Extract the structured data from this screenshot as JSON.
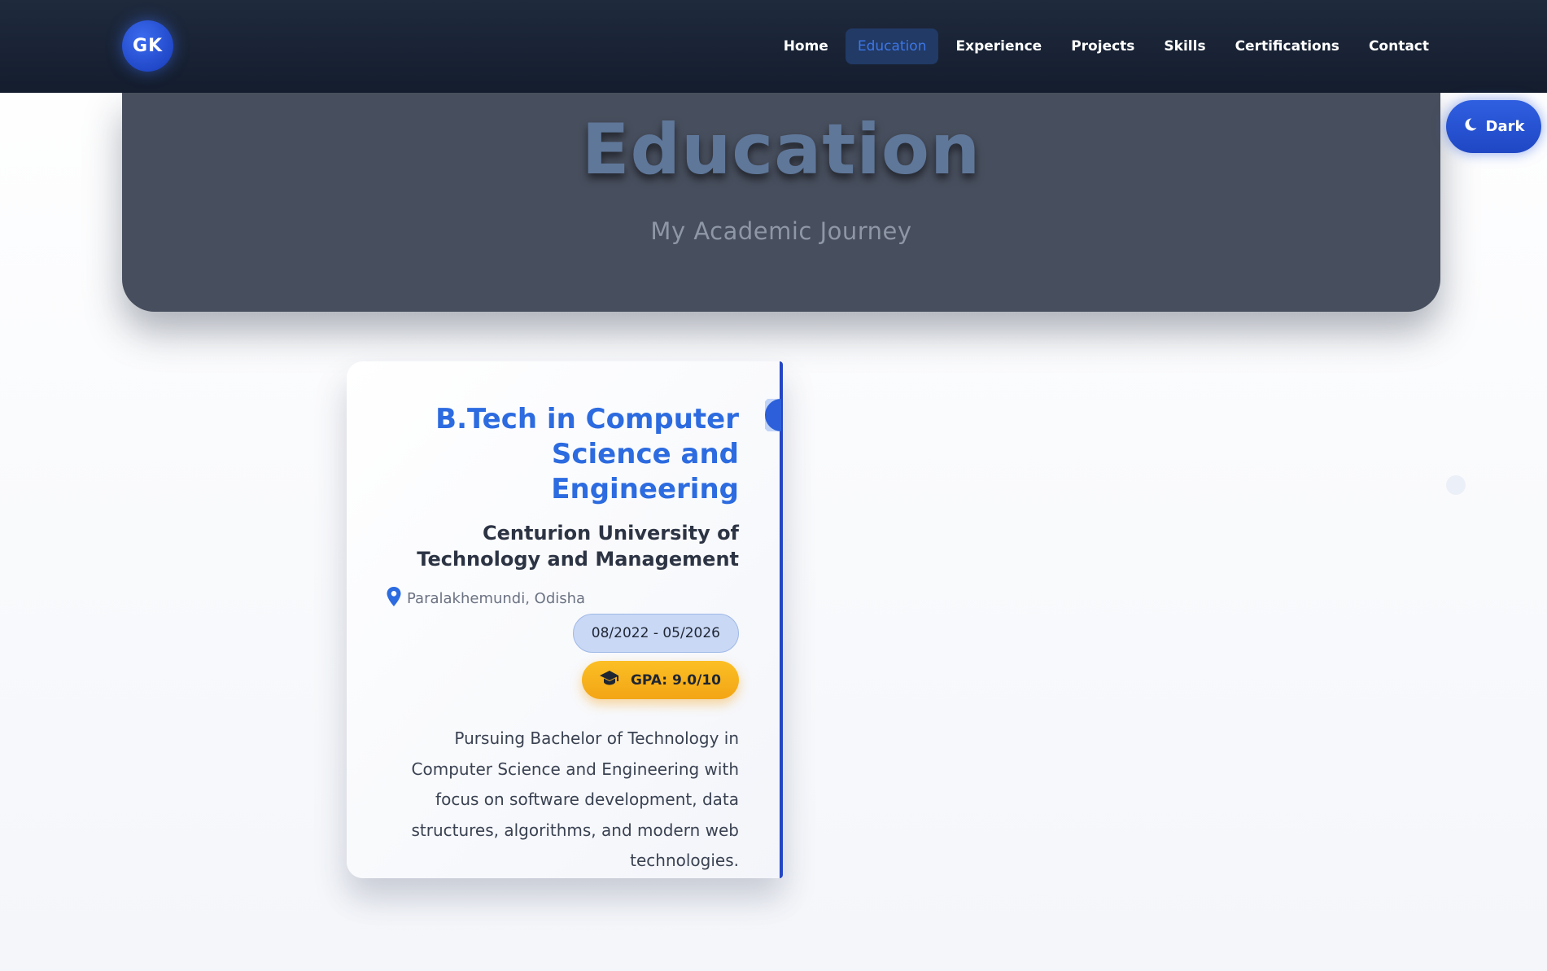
{
  "nav": {
    "logo": "GK",
    "links": [
      "Home",
      "Education",
      "Experience",
      "Projects",
      "Skills",
      "Certifications",
      "Contact"
    ],
    "active": "Education"
  },
  "theme_toggle": {
    "label": "Dark",
    "icon": "moon-icon"
  },
  "hero": {
    "title": "Education",
    "subtitle": "My Academic Journey"
  },
  "education": {
    "degree": "B.Tech in Computer Science and Engineering",
    "university": "Centurion University of Technology and Management",
    "location": "Paralakhemundi, Odisha",
    "dates": "08/2022 - 05/2026",
    "gpa": "GPA: 9.0/10",
    "description": "Pursuing Bachelor of Technology in Computer Science and Engineering with focus on software development, data structures, algorithms, and modern web technologies."
  },
  "colors": {
    "nav_bg": "#1a2336",
    "accent": "#2c6be0",
    "gpa": "#fbbf24",
    "hero_bg": "#474e5d"
  }
}
